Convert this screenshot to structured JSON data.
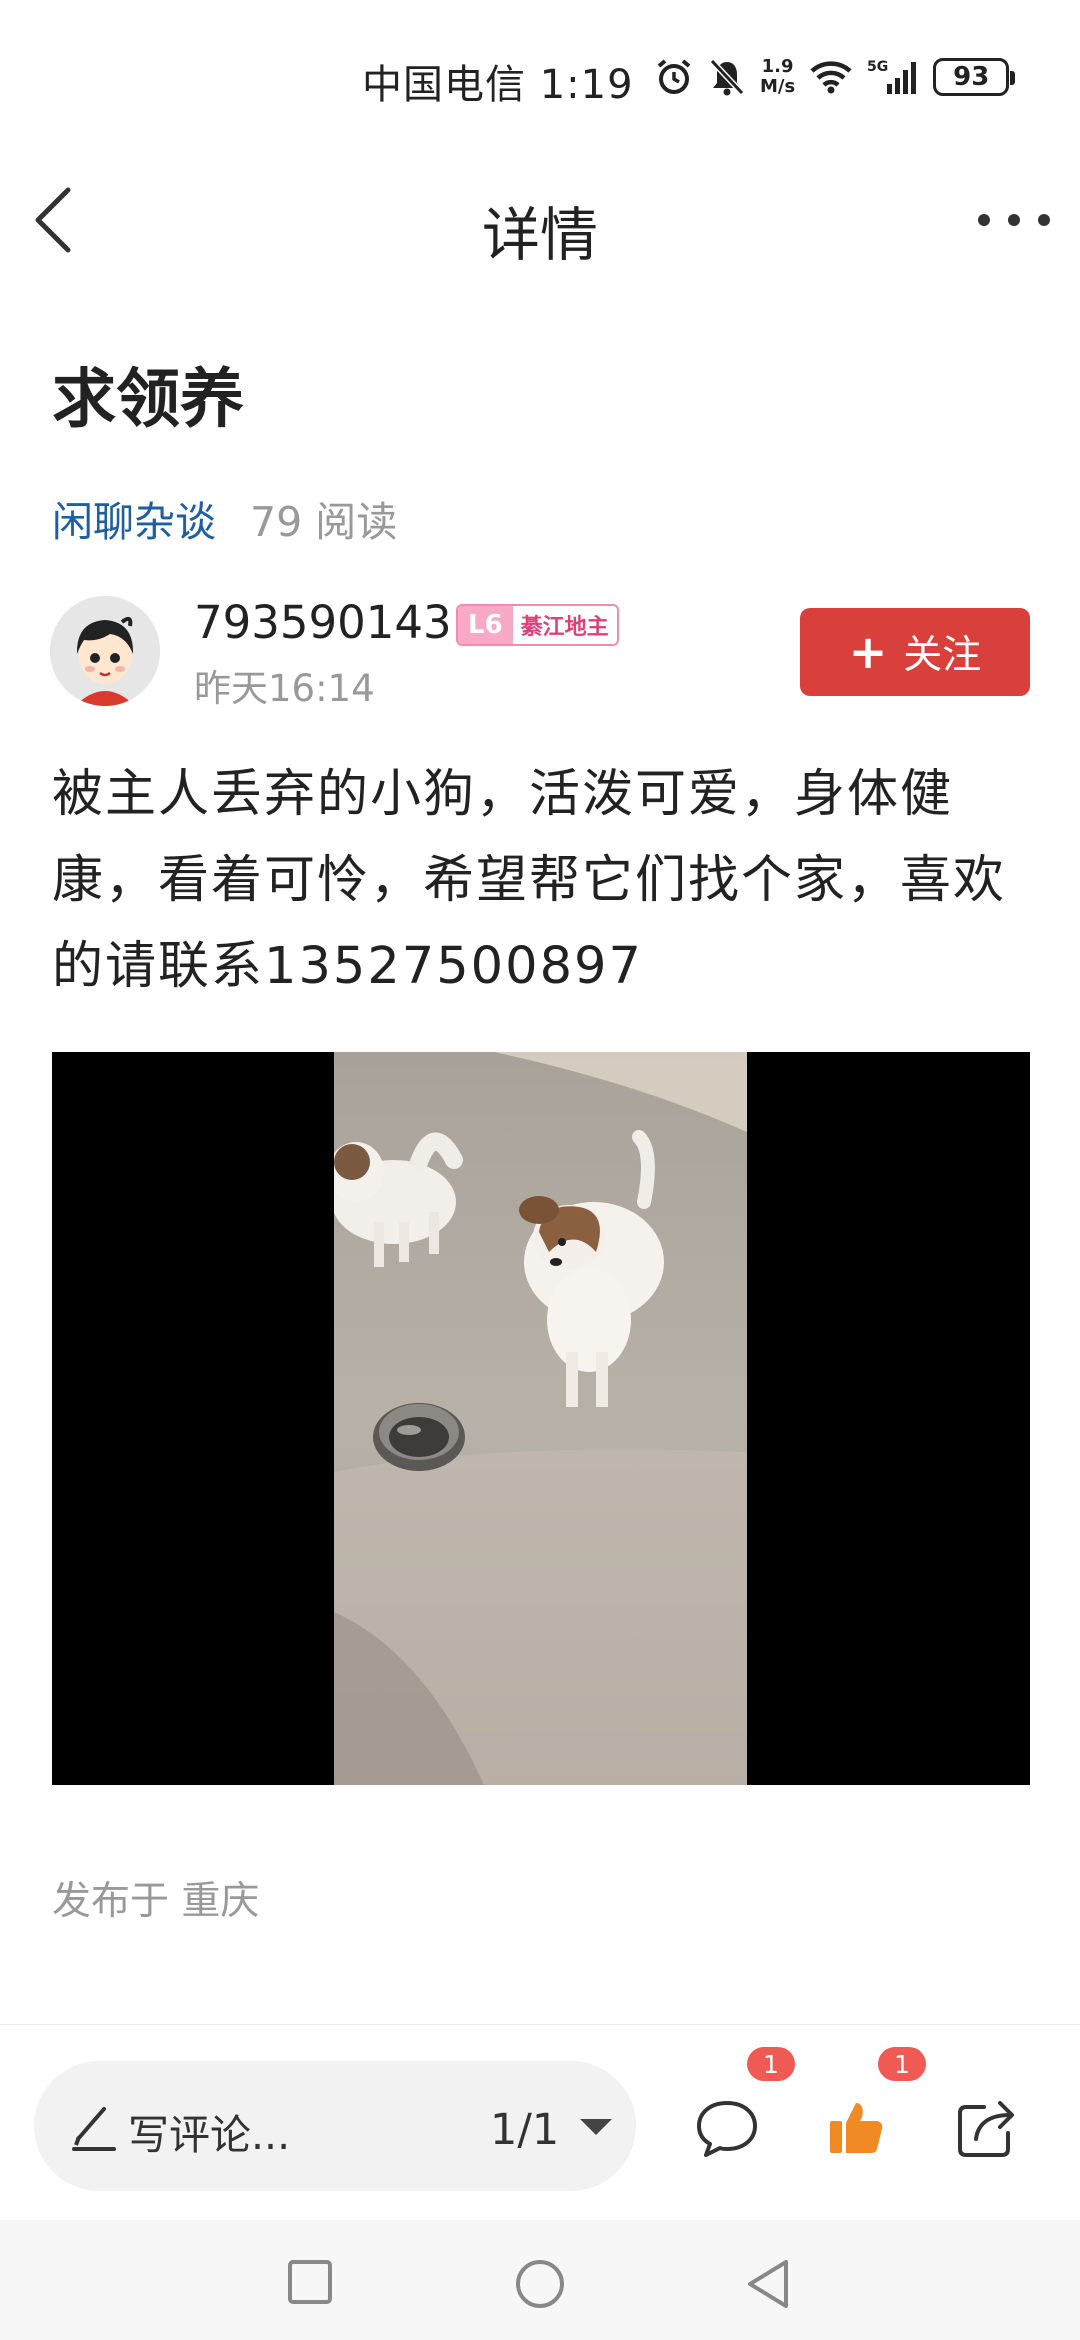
{
  "status_bar": {
    "carrier_time": "中国电信 1:19",
    "net_speed_value": "1.9",
    "net_speed_unit": "M/s",
    "battery": "93",
    "network": "5G"
  },
  "nav": {
    "title": "详情"
  },
  "post": {
    "title": "求领养",
    "category": "闲聊杂谈",
    "reads": "79 阅读",
    "body": "被主人丢弃的小狗，活泼可爱，身体健康，看着可怜，希望帮它们找个家，喜欢的请联系13527500897",
    "location": "发布于 重庆"
  },
  "author": {
    "name": "793590143",
    "level": "L6",
    "level_title": "綦江地主",
    "time": "昨天16:14",
    "follow_label": "关注"
  },
  "bottom_bar": {
    "comment_placeholder": "写评论...",
    "page_indicator": "1/1",
    "comment_count": "1",
    "like_count": "1"
  },
  "colors": {
    "accent_red": "#d9403b",
    "link_blue": "#1f5fa0",
    "like_orange": "#f08a24",
    "badge_red": "#ef5a55"
  },
  "icons": [
    "back-icon",
    "more-icon",
    "alarm-icon",
    "mute-icon",
    "wifi-icon",
    "signal-icon",
    "pencil-icon",
    "comment-icon",
    "like-icon",
    "share-icon",
    "recent-apps-icon",
    "home-icon",
    "back-nav-icon"
  ]
}
